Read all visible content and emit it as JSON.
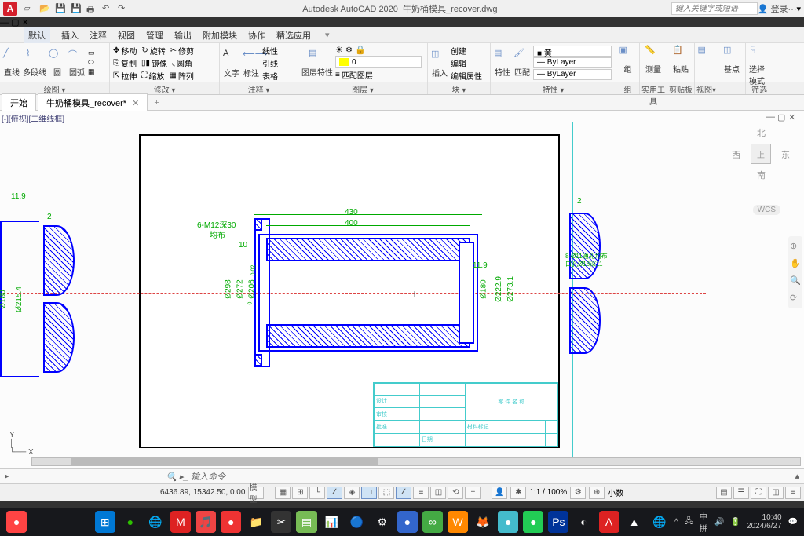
{
  "app": {
    "name": "Autodesk AutoCAD 2020",
    "file": "牛奶桶模具_recover.dwg",
    "search_placeholder": "键入关键字或短语",
    "login": "登录"
  },
  "menu": {
    "active": "默认",
    "items": [
      "插入",
      "注释",
      "视图",
      "管理",
      "输出",
      "附加模块",
      "协作",
      "精选应用"
    ]
  },
  "ribbon": {
    "draw": {
      "line": "直线",
      "polyline": "多段线",
      "circle": "圆",
      "arc": "圆弧",
      "label": "绘图"
    },
    "modify": {
      "move": "移动",
      "rotate": "旋转",
      "trim": "修剪",
      "copy": "复制",
      "mirror": "镜像",
      "fillet": "圆角",
      "stretch": "拉伸",
      "scale": "缩放",
      "array": "阵列",
      "label": "修改"
    },
    "annotate": {
      "text": "文字",
      "dim": "标注",
      "linear": "线性",
      "leader": "引线",
      "table": "表格",
      "label": "注释"
    },
    "layer": {
      "props": "图层特性",
      "match": "匹配图层",
      "layer0": "0",
      "label": "图层"
    },
    "block": {
      "insert": "插入",
      "create": "创建",
      "edit": "编辑",
      "editattr": "编辑属性",
      "label": "块"
    },
    "props": {
      "props": "特性",
      "match": "匹配",
      "bylayer": "ByLayer",
      "yellow": "黄",
      "label": "特性"
    },
    "group": {
      "group": "组",
      "label": "组"
    },
    "util": {
      "measure": "测量",
      "label": "实用工具"
    },
    "clip": {
      "paste": "粘贴",
      "label": "剪贴板"
    },
    "view": {
      "label": "视图"
    },
    "base": {
      "base": "基点",
      "label": ""
    },
    "select": {
      "select": "选择模式",
      "label": "筛选"
    }
  },
  "tabs": {
    "start": "开始",
    "doc": "牛奶桶模具_recover*"
  },
  "view": {
    "label": "[-][俯视][二维线框]"
  },
  "viewcube": {
    "top": "上",
    "n": "北",
    "s": "南",
    "e": "东",
    "w": "西",
    "wcs": "WCS"
  },
  "drawing": {
    "dims": {
      "d430": "430",
      "d400": "400",
      "thread": "6-M12深30",
      "dist": "均布",
      "d10": "10",
      "d298": "Ø298",
      "d272": "Ø272",
      "d206": "Ø206",
      "d119": "11.9",
      "d180": "Ø180",
      "d2229": "Ø222.9",
      "d2731": "Ø273.1",
      "left119": "11.9",
      "left180": "Ø180",
      "left2154": "Ø215.4",
      "r2": "2",
      "right_note": "8-Ø11通孔均布",
      "right_note2": "口孔Ø18深11",
      "d002": "0.02",
      "d0": "0"
    },
    "titleblock": {
      "partname": "零 件 名 称",
      "design": "设计",
      "review": "审核",
      "approve": "批准",
      "date": "日期",
      "matl": "材料标记"
    }
  },
  "cmd": {
    "prompt": "输入命令"
  },
  "status": {
    "coords": "6436.89, 15342.50, 0.00",
    "model": "模型",
    "scale": "1:1 / 100%",
    "decimal": "小数"
  },
  "clock": {
    "time": "10:40",
    "date": "2024/6/27"
  }
}
